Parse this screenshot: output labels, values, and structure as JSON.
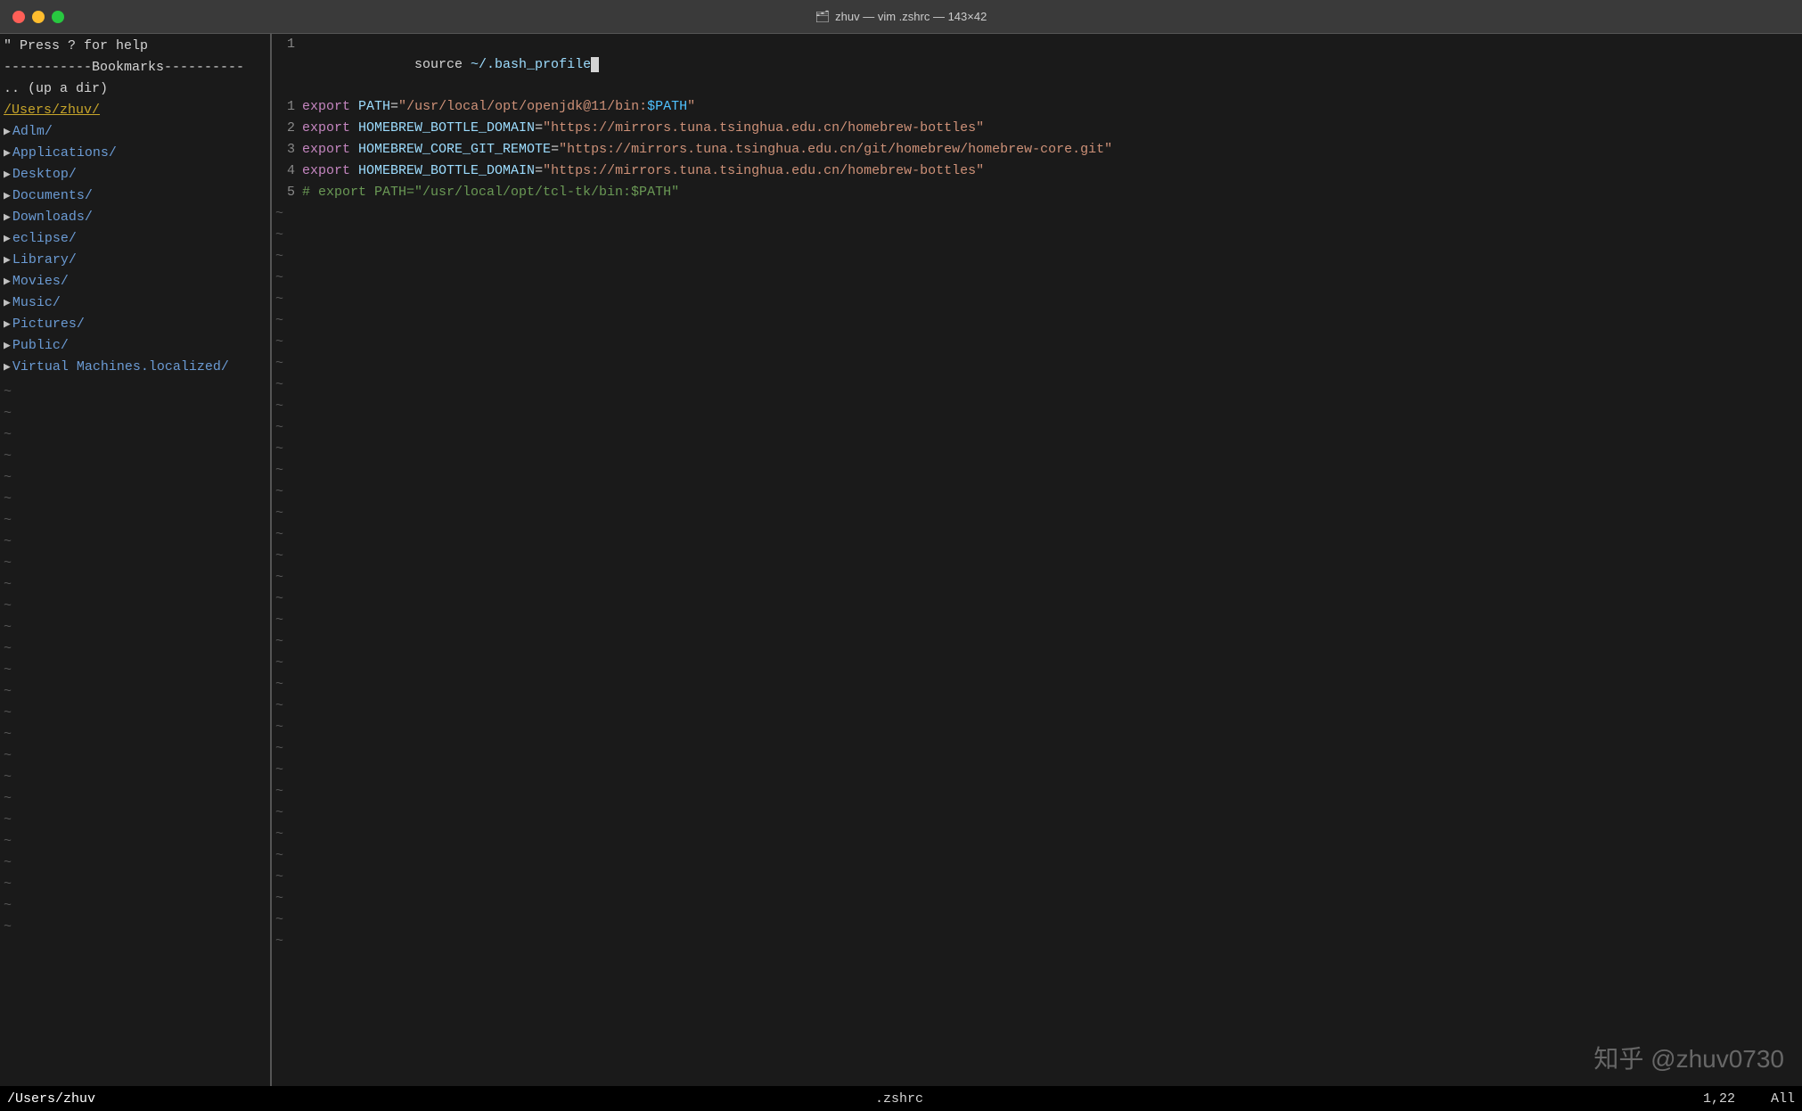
{
  "window": {
    "title": "zhuv — vim .zshrc — 143×42",
    "folder_icon": "📁"
  },
  "titlebar": {
    "title_prefix": "zhuv — vim .zshrc — 143×42"
  },
  "left_panel": {
    "help_text": "\" Press ? for help",
    "separator": "-----------Bookmarks----------",
    "updir": ".. (up a dir)",
    "current_dir": "/Users/zhuv/",
    "dirs": [
      "Adlm/",
      "Applications/",
      "Desktop/",
      "Documents/",
      "Downloads/",
      "eclipse/",
      "Library/",
      "Movies/",
      "Music/",
      "Pictures/",
      "Public/",
      "Virtual Machines.localized/"
    ]
  },
  "editor": {
    "lines": [
      {
        "num": "1",
        "content": "source ~/.bash_profile",
        "type": "source"
      },
      {
        "num": "1",
        "content": "export PATH=\"/usr/local/opt/openjdk@11/bin:$PATH\"",
        "type": "export_path"
      },
      {
        "num": "2",
        "content": "export HOMEBREW_BOTTLE_DOMAIN=\"https://mirrors.tuna.tsinghua.edu.cn/homebrew-bottles\"",
        "type": "export_str"
      },
      {
        "num": "3",
        "content": "export HOMEBREW_CORE_GIT_REMOTE=\"https://mirrors.tuna.tsinghua.edu.cn/git/homebrew/homebrew-core.git\"",
        "type": "export_str"
      },
      {
        "num": "4",
        "content": "export HOMEBREW_BOTTLE_DOMAIN=\"https://mirrors.tuna.tsinghua.edu.cn/homebrew-bottles\"",
        "type": "export_str"
      },
      {
        "num": "5",
        "content": "# export PATH=\"/usr/local/opt/tcl-tk/bin:$PATH\"",
        "type": "comment"
      }
    ]
  },
  "statusbar": {
    "left": "/Users/zhuv",
    "center": ".zshrc",
    "position": "1,22",
    "range": "All"
  },
  "watermark": {
    "text": "知乎 @zhuv0730"
  }
}
